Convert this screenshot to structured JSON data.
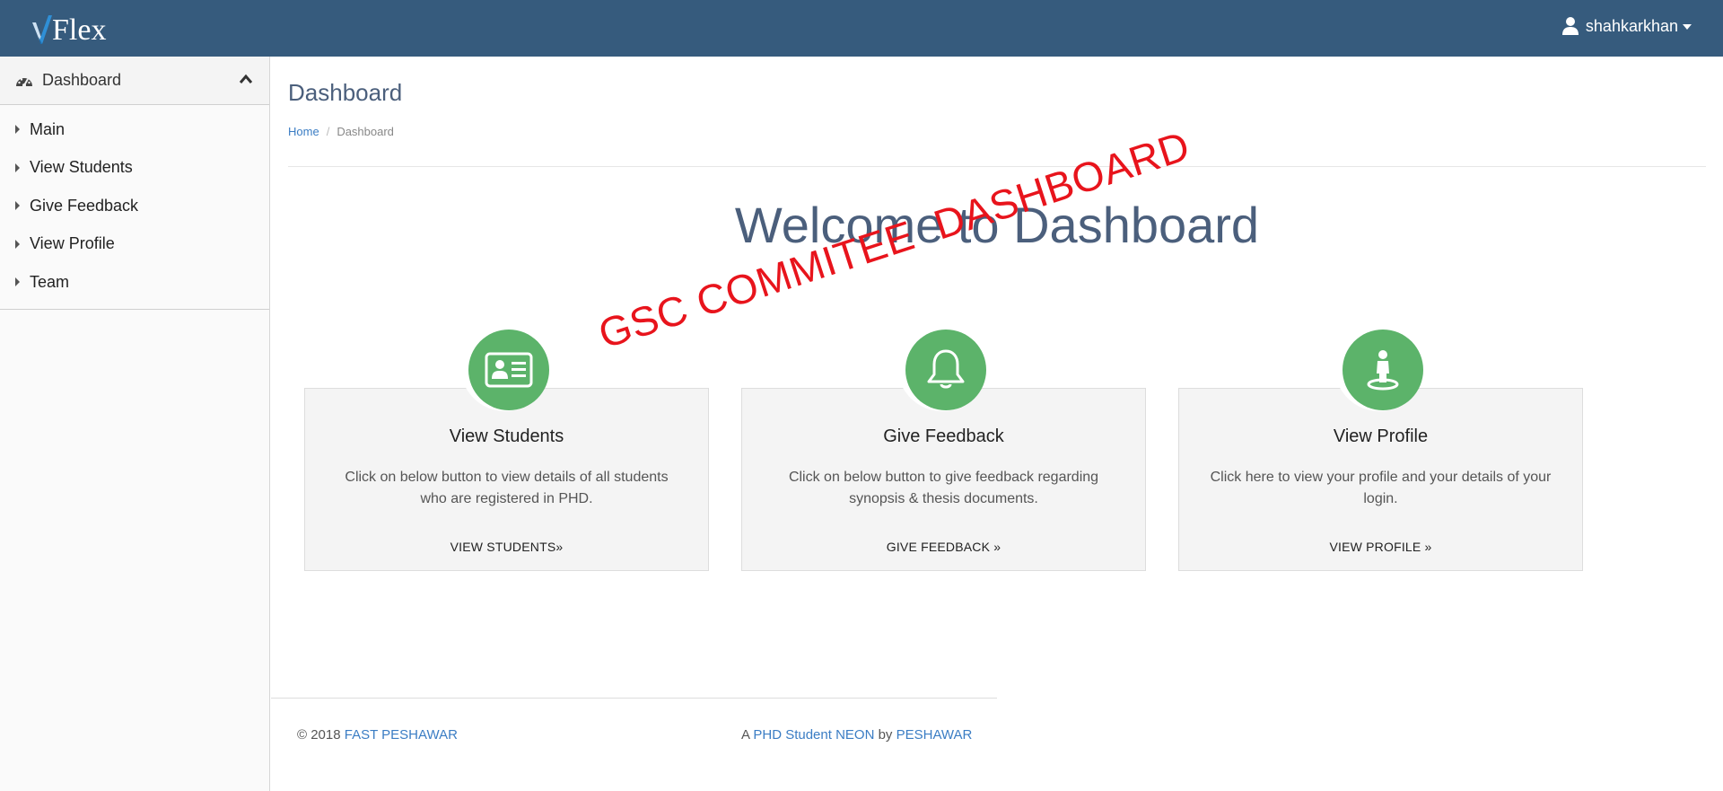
{
  "header": {
    "logo_text": "Flex",
    "username": "shahkarkhan"
  },
  "sidebar": {
    "section_label": "Dashboard",
    "items": [
      {
        "label": "Main"
      },
      {
        "label": "View Students"
      },
      {
        "label": "Give Feedback"
      },
      {
        "label": "View Profile"
      },
      {
        "label": "Team"
      }
    ]
  },
  "main": {
    "title": "Dashboard",
    "breadcrumb": {
      "home": "Home",
      "current": "Dashboard"
    },
    "welcome": "Welcome to Dashboard",
    "stamp": "GSC COMMITEE  DASHBOARD",
    "cards": [
      {
        "icon": "id-card-icon",
        "title": "View Students",
        "text": "Click on below button to view details of all students who are registered in PHD.",
        "cta": "VIEW STUDENTS»"
      },
      {
        "icon": "bell-icon",
        "title": "Give Feedback",
        "text": "Click on below button to give feedback regarding synopsis & thesis documents.",
        "cta": "GIVE FEEDBACK »"
      },
      {
        "icon": "street-view-icon",
        "title": "View Profile",
        "text": "Click here to view your profile and your details of your login.",
        "cta": "VIEW PROFILE »"
      }
    ]
  },
  "footer": {
    "copyright": "© 2018 ",
    "org_link": "FAST PESHAWAR",
    "right_prefix": "A ",
    "right_link1": "PHD Student NEON",
    "right_mid": " by ",
    "right_link2": "PESHAWAR"
  },
  "colors": {
    "topbar": "#365b7d",
    "accent_green": "#5cb36a",
    "title_blue": "#4b5f7c",
    "link_blue": "#3b7dc4",
    "stamp_red": "#e8141c"
  }
}
